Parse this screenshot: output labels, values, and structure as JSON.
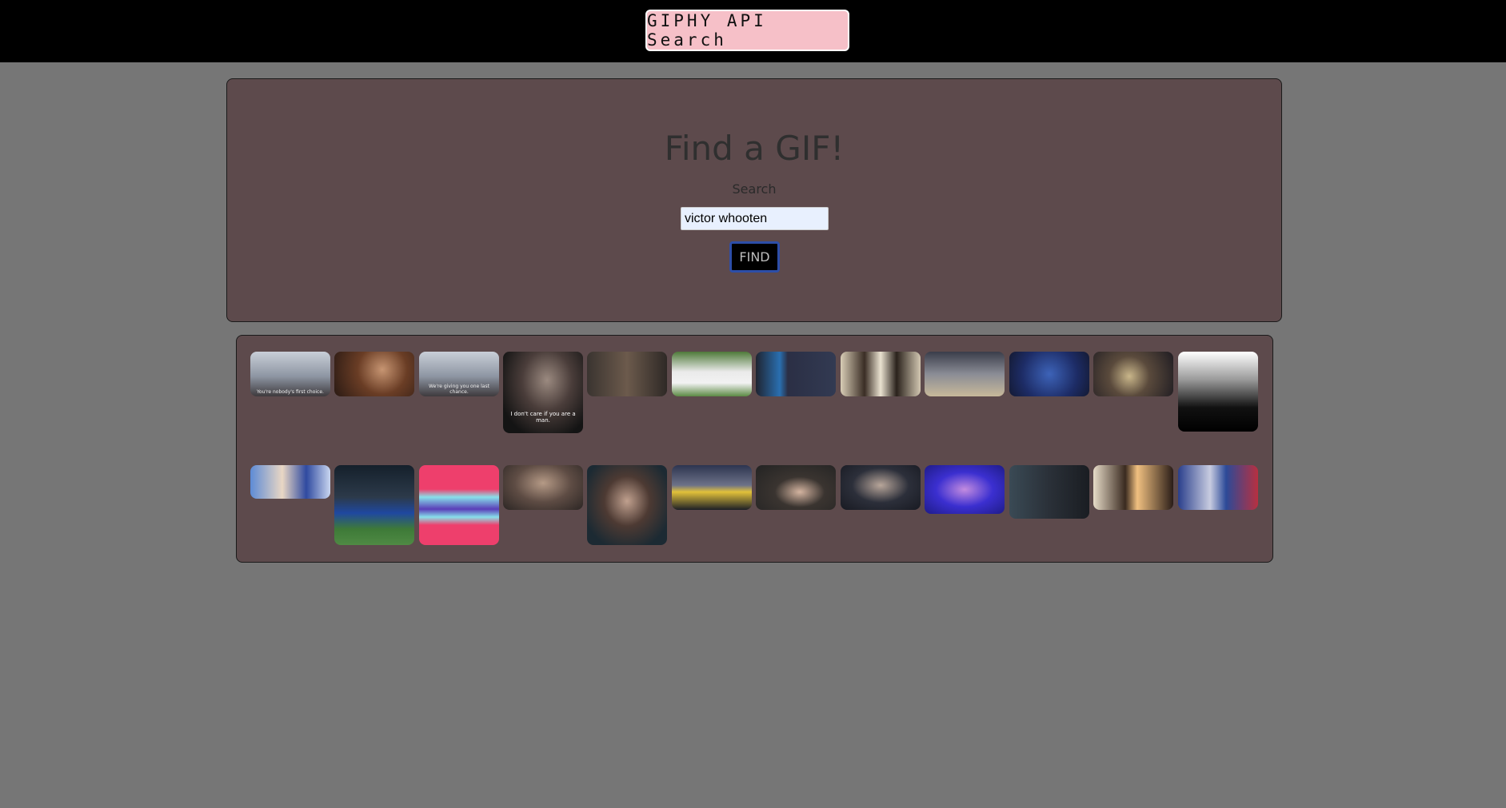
{
  "header": {
    "brand": "GIPHY API Search"
  },
  "search": {
    "title": "Find a GIF!",
    "label": "Search",
    "value": "victor whooten",
    "button_label": "FIND"
  },
  "results": {
    "row1": [
      {
        "name": "gif-result-1",
        "caption": "You're nobody's first choice."
      },
      {
        "name": "gif-result-2",
        "caption": ""
      },
      {
        "name": "gif-result-3",
        "caption": "We're giving you one last chance."
      },
      {
        "name": "gif-result-4",
        "caption": "I don't care if you are a man."
      },
      {
        "name": "gif-result-5",
        "caption": ""
      },
      {
        "name": "gif-result-6",
        "caption": ""
      },
      {
        "name": "gif-result-7",
        "caption": ""
      },
      {
        "name": "gif-result-8",
        "caption": ""
      },
      {
        "name": "gif-result-9",
        "caption": ""
      },
      {
        "name": "gif-result-10",
        "caption": ""
      },
      {
        "name": "gif-result-11",
        "caption": ""
      },
      {
        "name": "gif-result-12",
        "caption": ""
      }
    ],
    "row2": [
      {
        "name": "gif-result-13",
        "caption": ""
      },
      {
        "name": "gif-result-14",
        "caption": ""
      },
      {
        "name": "gif-result-15",
        "caption": ""
      },
      {
        "name": "gif-result-16",
        "caption": ""
      },
      {
        "name": "gif-result-17",
        "caption": ""
      },
      {
        "name": "gif-result-18",
        "caption": ""
      },
      {
        "name": "gif-result-19",
        "caption": ""
      },
      {
        "name": "gif-result-20",
        "caption": ""
      },
      {
        "name": "gif-result-21",
        "caption": ""
      },
      {
        "name": "gif-result-22",
        "caption": ""
      },
      {
        "name": "gif-result-23",
        "caption": ""
      },
      {
        "name": "gif-result-24",
        "caption": ""
      }
    ]
  }
}
